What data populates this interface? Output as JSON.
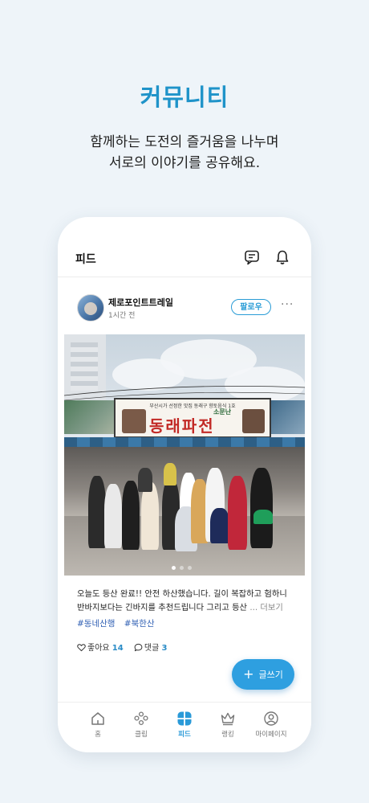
{
  "headline": "커뮤니티",
  "subline1": "함께하는 도전의 즐거움을 나누며",
  "subline2": "서로의 이야기를 공유해요.",
  "app": {
    "title": "피드",
    "post": {
      "author": "제로포인트트레일",
      "time": "1시간 전",
      "follow_label": "팔로우",
      "more_label": "···",
      "photo": {
        "sign_small": "부산시가 선정한 맛집 동래구 향토음식 1호",
        "sign_mini": "소문난",
        "sign_big": "동래파전"
      },
      "body_line1": "오늘도 등산 완료!! 안전 하산했습니다. 길이 복잡하고 험하니",
      "body_line2": "반바지보다는 긴바지를 추천드립니다 그리고 등산",
      "more_text": "... 더보기",
      "tags": [
        "#동네산행",
        "#북한산"
      ],
      "likes_label": "좋아요",
      "likes_count": "14",
      "comments_label": "댓글",
      "comments_count": "3"
    },
    "fab_label": "글쓰기",
    "nav": [
      {
        "label": "홈",
        "icon": "home-icon"
      },
      {
        "label": "클립",
        "icon": "group-icon"
      },
      {
        "label": "피드",
        "icon": "feed-icon",
        "active": true
      },
      {
        "label": "랭킹",
        "icon": "crown-icon"
      },
      {
        "label": "마이페이지",
        "icon": "person-icon"
      }
    ]
  },
  "colors": {
    "accent": "#1f93c9",
    "background": "#eef4f9",
    "tag": "#2f5fb3",
    "fab": "#2e9fe0"
  }
}
